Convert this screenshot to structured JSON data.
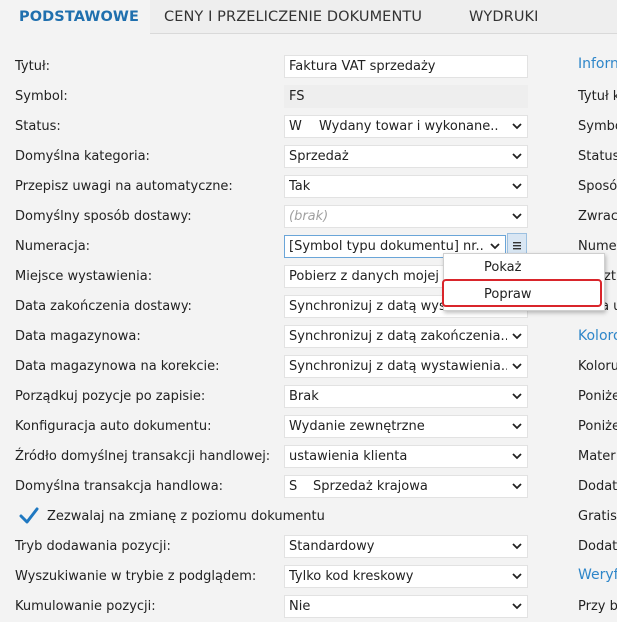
{
  "tabs": [
    {
      "label": "PODSTAWOWE"
    },
    {
      "label": "CENY I PRZELICZENIE DOKUMENTU"
    },
    {
      "label": "WYDRUKI"
    }
  ],
  "form": {
    "rows": [
      {
        "label": "Tytuł:",
        "value": "Faktura VAT sprzedaży"
      },
      {
        "label": "Symbol:",
        "value": "FS"
      },
      {
        "label": "Status:",
        "code": "W",
        "value": "Wydany towar i wykonane..."
      },
      {
        "label": "Domyślna kategoria:",
        "value": "Sprzedaż"
      },
      {
        "label": "Przepisz uwagi na automatyczne:",
        "value": "Tak"
      },
      {
        "label": "Domyślny sposób dostawy:",
        "placeholder": "(brak)"
      },
      {
        "label": "Numeracja:",
        "value": "[Symbol typu dokumentu] nr..."
      },
      {
        "label": "Miejsce wystawienia:",
        "value": "Pobierz z danych mojej f"
      },
      {
        "label": "Data zakończenia dostawy:",
        "value": "Synchronizuj z datą wystawienia"
      },
      {
        "label": "Data magazynowa:",
        "value": "Synchronizuj z datą zakończenia..."
      },
      {
        "label": "Data magazynowa na korekcie:",
        "value": "Synchronizuj z datą wystawienia..."
      },
      {
        "label": "Porządkuj pozycje po zapisie:",
        "value": "Brak"
      },
      {
        "label": "Konfiguracja auto dokumentu:",
        "value": "Wydanie zewnętrzne"
      },
      {
        "label": "Źródło domyślnej transakcji handlowej:",
        "value": "ustawienia klienta"
      },
      {
        "label": "Domyślna transakcja handlowa:",
        "code": "S",
        "value": "Sprzedaż krajowa"
      }
    ],
    "checkbox": {
      "label": "Zezwalaj na zmianę z poziomu dokumentu",
      "checked": true
    },
    "rows2": [
      {
        "label": "Tryb dodawania pozycji:",
        "value": "Standardowy"
      },
      {
        "label": "Wyszukiwanie w trybie z podglądem:",
        "value": "Tylko kod kreskowy"
      },
      {
        "label": "Kumulowanie pozycji:",
        "value": "Nie"
      }
    ]
  },
  "right_column": {
    "items": [
      "Inforn",
      "Tytuł k",
      "Symbo",
      "Status",
      "Sposó",
      "Zwrac",
      "Nume",
      "zt",
      "Data u",
      "Koloro",
      "Koloru",
      "Poniże",
      "Poniże",
      "Mater",
      "Dodat",
      "Gratis",
      "Dodat",
      "Weryf",
      "Przy b"
    ]
  },
  "popup_menu": {
    "items": [
      "Pokaż",
      "Popraw"
    ],
    "highlighted": "Popraw"
  },
  "colors": {
    "accent": "#1f6fae",
    "highlight": "#d9252b",
    "section": "#2e86c9"
  }
}
